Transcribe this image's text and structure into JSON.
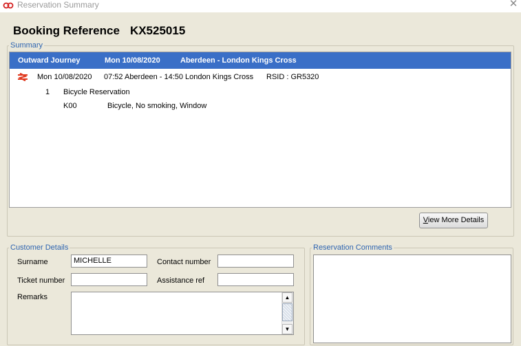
{
  "window": {
    "title": "Reservation Summary",
    "close_label": "✕"
  },
  "booking": {
    "label": "Booking Reference",
    "reference": "KX525015"
  },
  "summary": {
    "legend": "Summary",
    "header": {
      "journey_type": "Outward Journey",
      "date": "Mon 10/08/2020",
      "route": "Aberdeen - London Kings Cross"
    },
    "journey": {
      "date": "Mon 10/08/2020",
      "times": "07:52 Aberdeen - 14:50 London Kings Cross",
      "rsid": "RSID : GR5320"
    },
    "reservation": {
      "count": "1",
      "type": "Bicycle Reservation",
      "code": "K00",
      "details": "Bicycle, No smoking, Window"
    },
    "view_more_prefix": "V",
    "view_more_rest": "iew More Details"
  },
  "customer": {
    "legend": "Customer Details",
    "surname_label": "Surname",
    "surname_value": "MICHELLE",
    "contact_label": "Contact number",
    "contact_value": "",
    "ticket_label": "Ticket number",
    "ticket_value": "",
    "assistance_label": "Assistance ref",
    "assistance_value": "",
    "remarks_label": "Remarks"
  },
  "comments": {
    "legend": "Reservation Comments"
  },
  "colors": {
    "accent": "#3a6fc7",
    "legend": "#2e64b0",
    "rail_icon": "#e0381e",
    "background": "#ebe8da"
  }
}
